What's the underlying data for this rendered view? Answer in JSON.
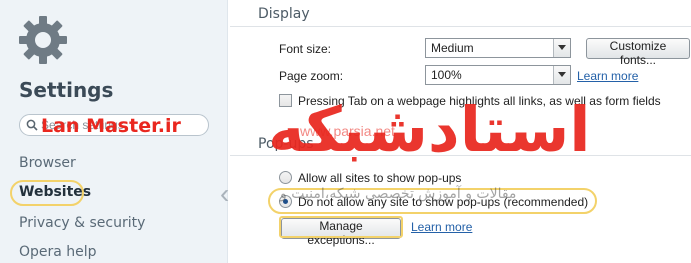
{
  "sidebar": {
    "title": "Settings",
    "search_placeholder": "Search settings",
    "items": [
      {
        "label": "Browser"
      },
      {
        "label": "Websites"
      },
      {
        "label": "Privacy & security"
      },
      {
        "label": "Opera help"
      }
    ],
    "active_item": "Websites"
  },
  "display": {
    "section_title": "Display",
    "font_size_label": "Font size:",
    "font_size_value": "Medium",
    "customize_fonts_button": "Customize fonts...",
    "page_zoom_label": "Page zoom:",
    "page_zoom_value": "100%",
    "learn_more_link": "Learn more",
    "tab_highlight_checkbox_label": "Pressing Tab on a webpage highlights all links, as well as form fields",
    "tab_highlight_checked": false
  },
  "popups": {
    "section_title": "Pop-ups",
    "allow_label": "Allow all sites to show pop-ups",
    "block_label": "Do not allow any site to show pop-ups (recommended)",
    "selected": "block",
    "manage_exceptions_button": "Manage exceptions...",
    "learn_more_link": "Learn more"
  },
  "watermark": {
    "main_text": "استادشبکه",
    "brand": "Lan Master.ir",
    "site": "www.parsia.net",
    "tagline": "مقالات و آموزش تخصصی شبکه،امنیت و"
  },
  "colors": {
    "accent_link": "#2461a8",
    "highlight_outline": "#f3d26a",
    "watermark_red": "#e9271f"
  }
}
